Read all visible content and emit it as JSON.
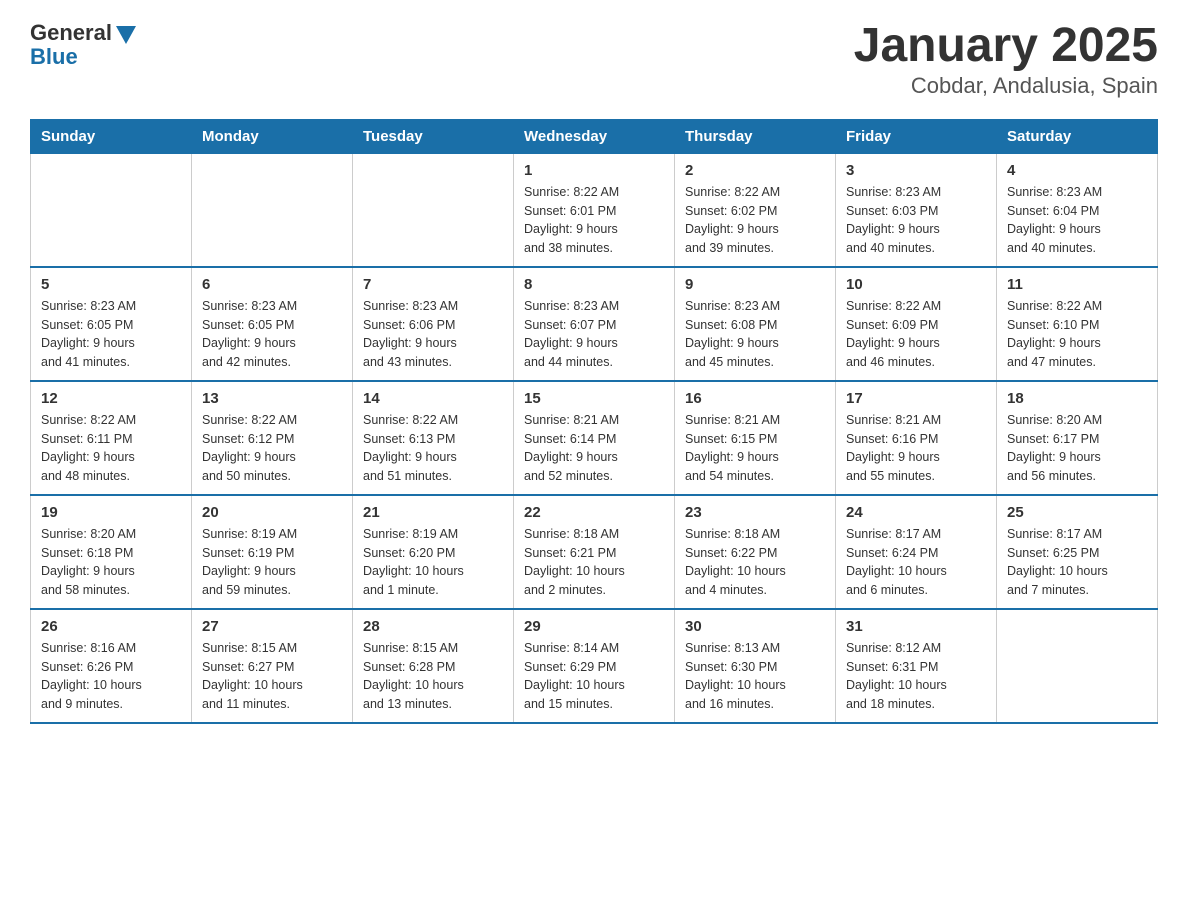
{
  "logo": {
    "general": "General",
    "blue": "Blue"
  },
  "title": "January 2025",
  "subtitle": "Cobdar, Andalusia, Spain",
  "headers": [
    "Sunday",
    "Monday",
    "Tuesday",
    "Wednesday",
    "Thursday",
    "Friday",
    "Saturday"
  ],
  "weeks": [
    [
      {
        "day": "",
        "info": ""
      },
      {
        "day": "",
        "info": ""
      },
      {
        "day": "",
        "info": ""
      },
      {
        "day": "1",
        "info": "Sunrise: 8:22 AM\nSunset: 6:01 PM\nDaylight: 9 hours\nand 38 minutes."
      },
      {
        "day": "2",
        "info": "Sunrise: 8:22 AM\nSunset: 6:02 PM\nDaylight: 9 hours\nand 39 minutes."
      },
      {
        "day": "3",
        "info": "Sunrise: 8:23 AM\nSunset: 6:03 PM\nDaylight: 9 hours\nand 40 minutes."
      },
      {
        "day": "4",
        "info": "Sunrise: 8:23 AM\nSunset: 6:04 PM\nDaylight: 9 hours\nand 40 minutes."
      }
    ],
    [
      {
        "day": "5",
        "info": "Sunrise: 8:23 AM\nSunset: 6:05 PM\nDaylight: 9 hours\nand 41 minutes."
      },
      {
        "day": "6",
        "info": "Sunrise: 8:23 AM\nSunset: 6:05 PM\nDaylight: 9 hours\nand 42 minutes."
      },
      {
        "day": "7",
        "info": "Sunrise: 8:23 AM\nSunset: 6:06 PM\nDaylight: 9 hours\nand 43 minutes."
      },
      {
        "day": "8",
        "info": "Sunrise: 8:23 AM\nSunset: 6:07 PM\nDaylight: 9 hours\nand 44 minutes."
      },
      {
        "day": "9",
        "info": "Sunrise: 8:23 AM\nSunset: 6:08 PM\nDaylight: 9 hours\nand 45 minutes."
      },
      {
        "day": "10",
        "info": "Sunrise: 8:22 AM\nSunset: 6:09 PM\nDaylight: 9 hours\nand 46 minutes."
      },
      {
        "day": "11",
        "info": "Sunrise: 8:22 AM\nSunset: 6:10 PM\nDaylight: 9 hours\nand 47 minutes."
      }
    ],
    [
      {
        "day": "12",
        "info": "Sunrise: 8:22 AM\nSunset: 6:11 PM\nDaylight: 9 hours\nand 48 minutes."
      },
      {
        "day": "13",
        "info": "Sunrise: 8:22 AM\nSunset: 6:12 PM\nDaylight: 9 hours\nand 50 minutes."
      },
      {
        "day": "14",
        "info": "Sunrise: 8:22 AM\nSunset: 6:13 PM\nDaylight: 9 hours\nand 51 minutes."
      },
      {
        "day": "15",
        "info": "Sunrise: 8:21 AM\nSunset: 6:14 PM\nDaylight: 9 hours\nand 52 minutes."
      },
      {
        "day": "16",
        "info": "Sunrise: 8:21 AM\nSunset: 6:15 PM\nDaylight: 9 hours\nand 54 minutes."
      },
      {
        "day": "17",
        "info": "Sunrise: 8:21 AM\nSunset: 6:16 PM\nDaylight: 9 hours\nand 55 minutes."
      },
      {
        "day": "18",
        "info": "Sunrise: 8:20 AM\nSunset: 6:17 PM\nDaylight: 9 hours\nand 56 minutes."
      }
    ],
    [
      {
        "day": "19",
        "info": "Sunrise: 8:20 AM\nSunset: 6:18 PM\nDaylight: 9 hours\nand 58 minutes."
      },
      {
        "day": "20",
        "info": "Sunrise: 8:19 AM\nSunset: 6:19 PM\nDaylight: 9 hours\nand 59 minutes."
      },
      {
        "day": "21",
        "info": "Sunrise: 8:19 AM\nSunset: 6:20 PM\nDaylight: 10 hours\nand 1 minute."
      },
      {
        "day": "22",
        "info": "Sunrise: 8:18 AM\nSunset: 6:21 PM\nDaylight: 10 hours\nand 2 minutes."
      },
      {
        "day": "23",
        "info": "Sunrise: 8:18 AM\nSunset: 6:22 PM\nDaylight: 10 hours\nand 4 minutes."
      },
      {
        "day": "24",
        "info": "Sunrise: 8:17 AM\nSunset: 6:24 PM\nDaylight: 10 hours\nand 6 minutes."
      },
      {
        "day": "25",
        "info": "Sunrise: 8:17 AM\nSunset: 6:25 PM\nDaylight: 10 hours\nand 7 minutes."
      }
    ],
    [
      {
        "day": "26",
        "info": "Sunrise: 8:16 AM\nSunset: 6:26 PM\nDaylight: 10 hours\nand 9 minutes."
      },
      {
        "day": "27",
        "info": "Sunrise: 8:15 AM\nSunset: 6:27 PM\nDaylight: 10 hours\nand 11 minutes."
      },
      {
        "day": "28",
        "info": "Sunrise: 8:15 AM\nSunset: 6:28 PM\nDaylight: 10 hours\nand 13 minutes."
      },
      {
        "day": "29",
        "info": "Sunrise: 8:14 AM\nSunset: 6:29 PM\nDaylight: 10 hours\nand 15 minutes."
      },
      {
        "day": "30",
        "info": "Sunrise: 8:13 AM\nSunset: 6:30 PM\nDaylight: 10 hours\nand 16 minutes."
      },
      {
        "day": "31",
        "info": "Sunrise: 8:12 AM\nSunset: 6:31 PM\nDaylight: 10 hours\nand 18 minutes."
      },
      {
        "day": "",
        "info": ""
      }
    ]
  ]
}
